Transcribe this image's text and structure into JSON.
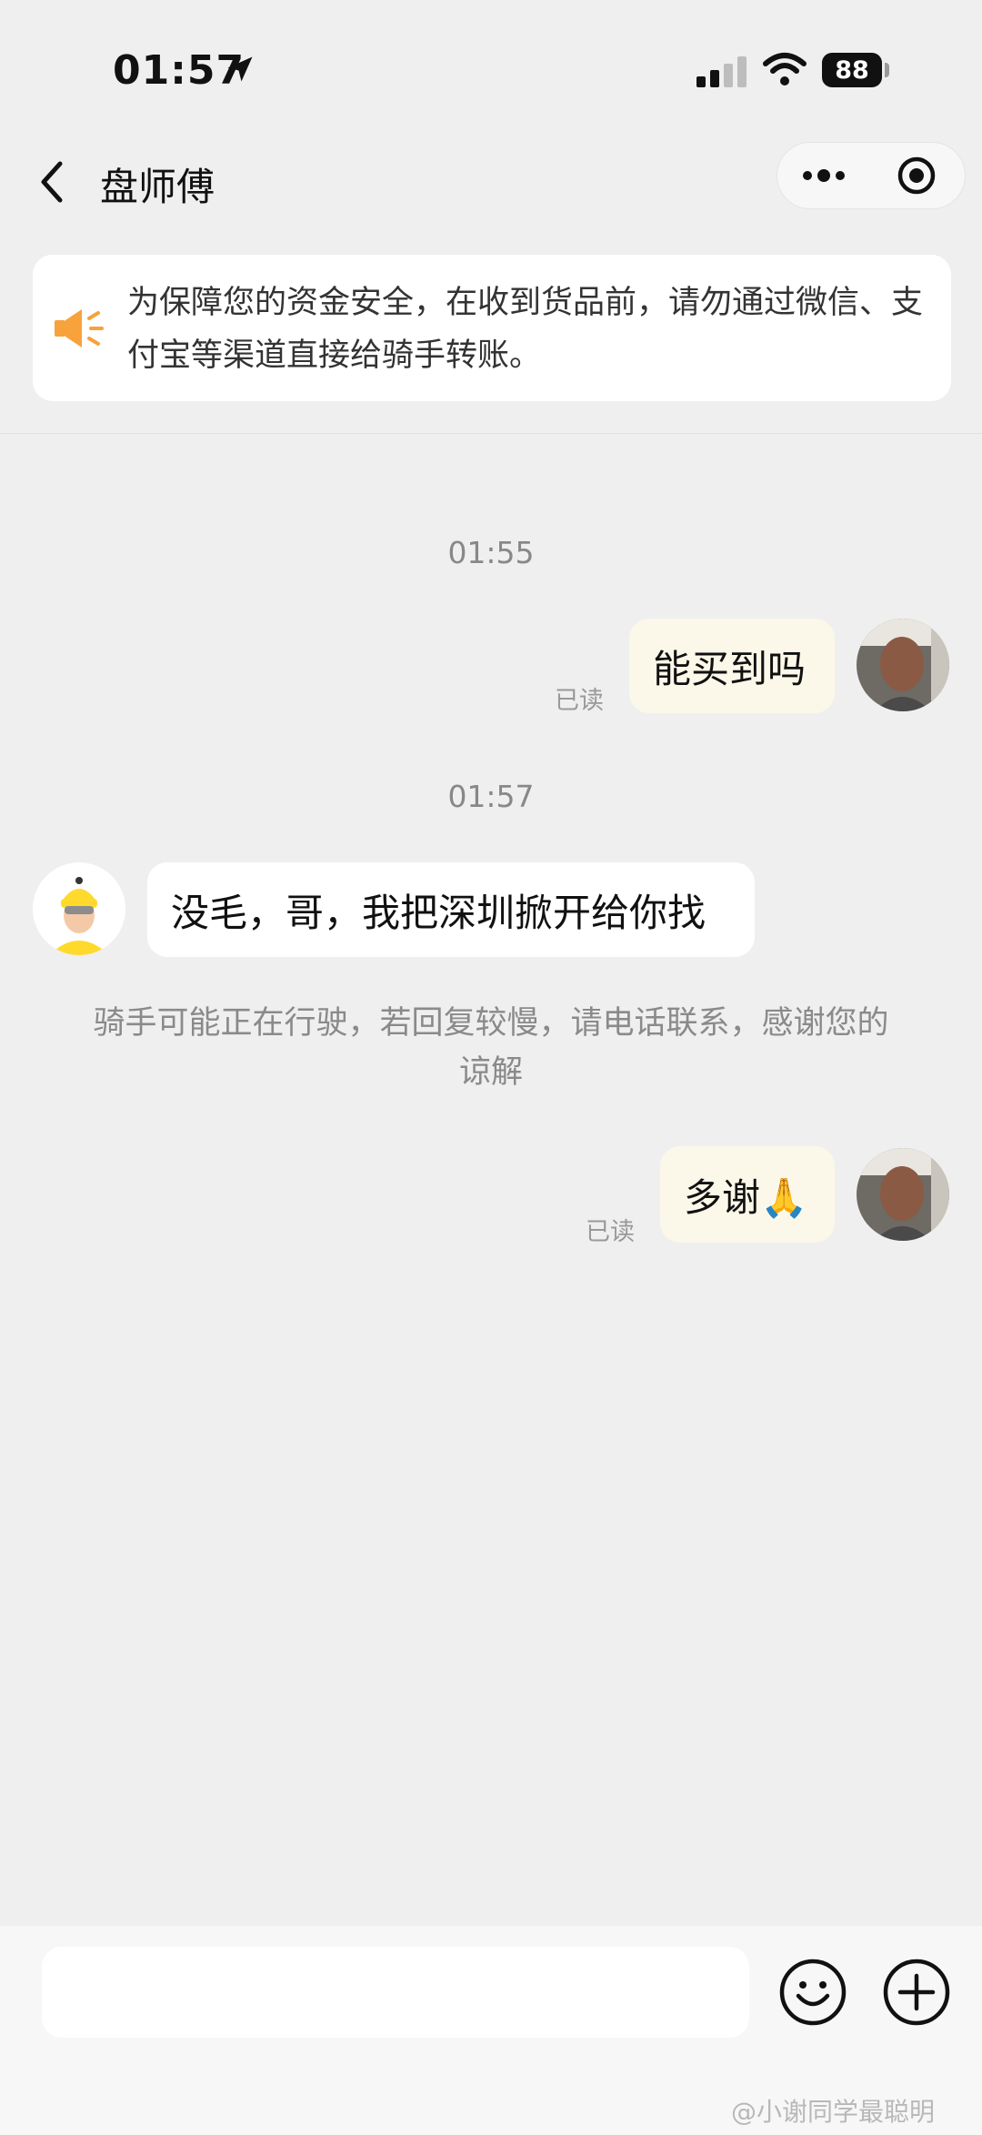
{
  "status_bar": {
    "time": "01:57",
    "battery": "88",
    "icons": [
      "location-arrow-icon",
      "signal-bars-icon",
      "wifi-icon",
      "battery-icon"
    ]
  },
  "nav": {
    "title": "盘师傅",
    "icons": [
      "back-chevron-icon",
      "more-dots-icon",
      "close-target-icon"
    ]
  },
  "notice": {
    "icon": "speaker-icon",
    "text": "为保障您的资金安全，在收到货品前，请勿通过微信、支付宝等渠道直接给骑手转账。"
  },
  "chat": {
    "ts1": "01:55",
    "msg1": "能买到吗",
    "read1": "已读",
    "ts2": "01:57",
    "msg2": "没毛，哥，我把深圳掀开给你找",
    "system": "骑手可能正在行驶，若回复较慢，请电话联系，感谢您的谅解",
    "msg3": "多谢🙏",
    "read3": "已读"
  },
  "input": {
    "placeholder": "",
    "icons": [
      "emoji-icon",
      "plus-icon"
    ]
  },
  "watermark": "@小谢同学最聪明",
  "colors": {
    "background": "#efefef",
    "my_bubble": "#fbf8e9",
    "their_bubble": "#ffffff",
    "notice_icon": "#f7a23a",
    "courier_yellow": "#ffd92c"
  }
}
